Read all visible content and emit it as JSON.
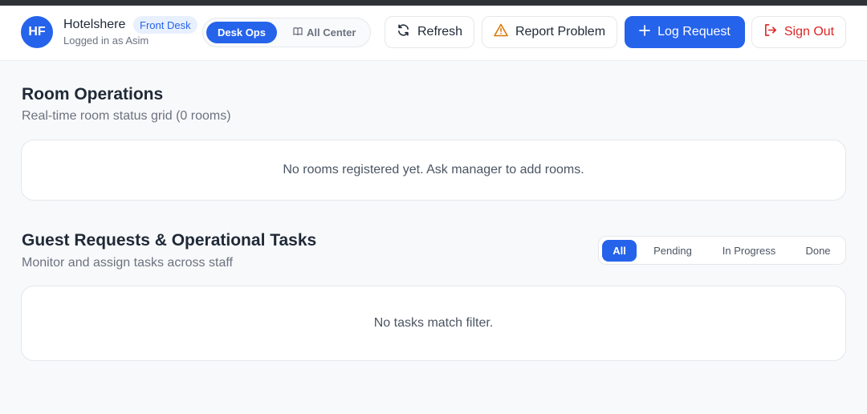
{
  "header": {
    "avatar_initials": "HF",
    "brand_name": "Hotelshere",
    "role_badge": "Front Desk",
    "logged_in_text": "Logged in as Asim",
    "view_toggle": {
      "active_label": "Desk Ops",
      "inactive_label": "All Center"
    },
    "buttons": {
      "refresh": "Refresh",
      "report": "Report Problem",
      "log_request": "Log Request",
      "sign_out": "Sign Out"
    }
  },
  "rooms": {
    "title": "Room Operations",
    "subtitle": "Real-time room status grid (0 rooms)",
    "empty_message": "No rooms registered yet. Ask manager to add rooms."
  },
  "tasks": {
    "title": "Guest Requests & Operational Tasks",
    "subtitle": "Monitor and assign tasks across staff",
    "filters": [
      "All",
      "Pending",
      "In Progress",
      "Done"
    ],
    "active_filter": "All",
    "empty_message": "No tasks match filter."
  },
  "colors": {
    "accent": "#2563eb",
    "danger": "#dc2626",
    "warning": "#d97706",
    "page_bg": "#f8f9fa"
  },
  "icons": {
    "refresh": "refresh-icon",
    "report": "warning-triangle-icon",
    "log_request": "plus-icon",
    "sign_out": "sign-out-icon",
    "all_center": "book-icon"
  }
}
